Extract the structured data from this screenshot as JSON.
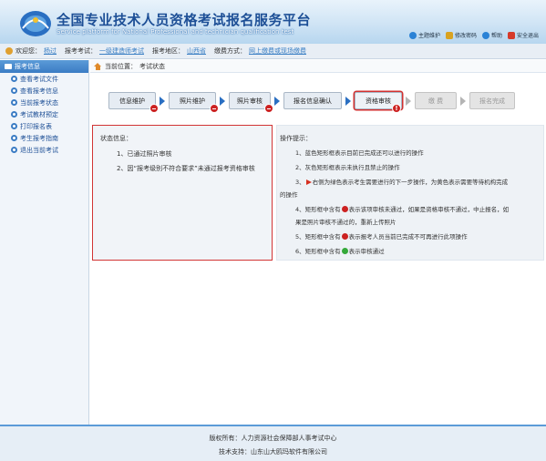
{
  "header": {
    "title_cn": "全国专业技术人员资格考试报名服务平台",
    "title_en": "Service platform for National Professional and technician qualification test",
    "links": [
      {
        "label": "主题维护",
        "icon": "home-icon"
      },
      {
        "label": "修改密码",
        "icon": "lock-icon"
      },
      {
        "label": "帮助",
        "icon": "help-icon"
      },
      {
        "label": "安全退出",
        "icon": "exit-icon"
      }
    ]
  },
  "info_bar": {
    "welcome_label": "欢迎您：",
    "user_name": "杨过",
    "exam_label": "报考考试：",
    "exam_value": "一级建造师考试",
    "region_label": "报考地区：",
    "region_value": "山西省",
    "pay_label": "缴费方式：",
    "pay_value": "网上缴费或现场缴费"
  },
  "sidebar": {
    "header": "报考信息",
    "items": [
      {
        "label": "查看考试文件"
      },
      {
        "label": "查看报考信息"
      },
      {
        "label": "当前报考状态"
      },
      {
        "label": "考试教材预定"
      },
      {
        "label": "打印报名表"
      },
      {
        "label": "考生报考指南"
      },
      {
        "label": "退出当前考试"
      }
    ]
  },
  "breadcrumb": {
    "label": "当前位置：",
    "current": "考试状态"
  },
  "steps": [
    {
      "label": "信息维护",
      "state": "done",
      "badge": "red"
    },
    {
      "label": "照片维护",
      "state": "done",
      "badge": "red"
    },
    {
      "label": "照片审核",
      "state": "done",
      "badge": "red"
    },
    {
      "label": "报名信息确认",
      "state": "done",
      "badge": ""
    },
    {
      "label": "资格审核",
      "state": "current",
      "badge": "!"
    },
    {
      "label": "缴 费",
      "state": "pending",
      "badge": ""
    },
    {
      "label": "报名完成",
      "state": "pending",
      "badge": ""
    }
  ],
  "status": {
    "title": "状态信息：",
    "lines": [
      "1、已通过照片审核",
      "2、因“报考级别不符合要求”未通过报考资格审核"
    ]
  },
  "tips": {
    "title": "操作提示：",
    "t1": "1、蓝色矩形框表示目前已完成还可以进行的操作",
    "t2": "2、灰色矩形框表示未执行且禁止的操作",
    "t3a": "3、",
    "t3b": "右侧为绿色表示考生需要进行的下一步操作，为黄色表示需要等待机构完成",
    "t3c": "的操作",
    "t4a": "4、矩形框中含有",
    "t4b": "表示该项审核未通过，如果是资格审核不通过，中止报名，如",
    "t4c": "果是照片审核不通过的，重新上传照片",
    "t5a": "5、矩形框中含有",
    "t5b": "表示报考人员当前已完成不可再进行此项操作",
    "t6a": "6、矩形框中含有",
    "t6b": "表示审核通过"
  },
  "footer": {
    "copyright": "版权所有：人力资源社会保障部人事考试中心",
    "support": "技术支持：山东山大鸥玛软件有限公司"
  },
  "colors": {
    "brand_blue": "#1d4f96",
    "highlight_red": "#d23535",
    "link_blue": "#3a7fc4"
  }
}
